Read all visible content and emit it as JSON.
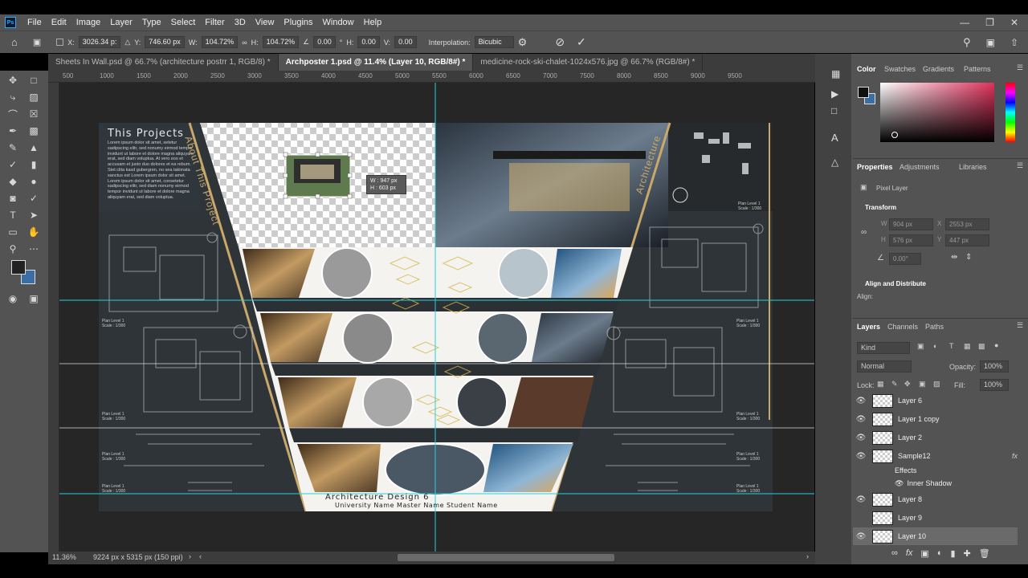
{
  "menu": {
    "items": [
      "File",
      "Edit",
      "Image",
      "Layer",
      "Type",
      "Select",
      "Filter",
      "3D",
      "View",
      "Plugins",
      "Window",
      "Help"
    ]
  },
  "options": {
    "x_label": "X:",
    "x": "3026.34 p:",
    "y_label": "Y:",
    "y": "746.60 px",
    "w_label": "W:",
    "w": "104.72%",
    "h_label": "H:",
    "h": "104.72%",
    "angle": "0.00",
    "angle_unit": "°",
    "hskew_label": "H:",
    "hskew": "0.00",
    "vskew_label": "V:",
    "vskew": "0.00",
    "interp_label": "Interpolation:",
    "interp": "Bicubic"
  },
  "tabs": [
    {
      "label": "Sheets In Wall.psd @ 66.7% (architecture postrr  1, RGB/8) *"
    },
    {
      "label": "Archposter 1.psd @ 11.4% (Layer 10, RGB/8#) *"
    },
    {
      "label": "medicine-rock-ski-chalet-1024x576.jpg @ 66.7% (RGB/8#) *"
    }
  ],
  "ruler": {
    "ticks": [
      "500",
      "1000",
      "1500",
      "2000",
      "2500",
      "3000",
      "3500",
      "4000",
      "4500",
      "5000",
      "5500",
      "6000",
      "6500",
      "7000",
      "7500",
      "8000",
      "8500",
      "9000",
      "9500"
    ]
  },
  "poster": {
    "title": "This Projects",
    "body": "Lorem ipsum dolor sit amet, setetur sadipscing elitr, sed nonumy eirmod tempor invidunt ut labore et dolore magna aliquyam erat, sed diam voluptua. At vero eos et accusam et justo duo dolores et ea rebum. Stet clita kasd gubergren, no sea takimata sanctus est Lorem ipsum dolor sit amet. Lorem ipsum dolor sit amet, consetetur sadipscing elitr, sed diam nonumy eirmod tempor invidunt ut labore et dolore magna aliquyam erat, sed diam voluptua.",
    "about": "About This Project",
    "architecture": "Architecture",
    "footer_title": "Architecture Design 6",
    "footer_sub": "University Name  Master Name  Student Name",
    "plan_label": "Plan Level 1",
    "plan_scale": "Scale : 1/300"
  },
  "transform_tip": {
    "w": "W :  947 px",
    "h": "H :  603 px"
  },
  "status": {
    "zoom": "11.36%",
    "doc": "9224 px x 5315 px (150 ppi)"
  },
  "color_panel": {
    "tabs": [
      "Color",
      "Swatches",
      "Gradients",
      "Patterns"
    ]
  },
  "properties": {
    "tabs": [
      "Properties",
      "Adjustments",
      "Libraries"
    ],
    "kind": "Pixel Layer",
    "transform": "Transform",
    "w": "904 px",
    "x": "2553 px",
    "h": "576 px",
    "y": "447 px",
    "angle": "0.00°",
    "align": "Align and Distribute",
    "align_label": "Align:"
  },
  "layers_panel": {
    "tabs": [
      "Layers",
      "Channels",
      "Paths"
    ],
    "kind": "Kind",
    "blend": "Normal",
    "opacity_label": "Opacity:",
    "opacity": "100%",
    "lock_label": "Lock:",
    "fill_label": "Fill:",
    "fill": "100%"
  },
  "layers": [
    {
      "name": "Layer 6",
      "visible": true
    },
    {
      "name": "Layer 1 copy",
      "visible": true
    },
    {
      "name": "Layer 2",
      "visible": true
    },
    {
      "name": "Sample12",
      "visible": true,
      "fx": "fx"
    },
    {
      "name": "Effects",
      "sub": true
    },
    {
      "name": "Inner Shadow",
      "sub": true
    },
    {
      "name": "Layer 8",
      "visible": true
    },
    {
      "name": "Layer 9",
      "visible": false
    },
    {
      "name": "Layer 10",
      "visible": true,
      "selected": true
    }
  ],
  "colors": {
    "accent": "#28d0d8",
    "gold": "#c9a86a",
    "panel": "#535353",
    "dark": "#262626"
  }
}
